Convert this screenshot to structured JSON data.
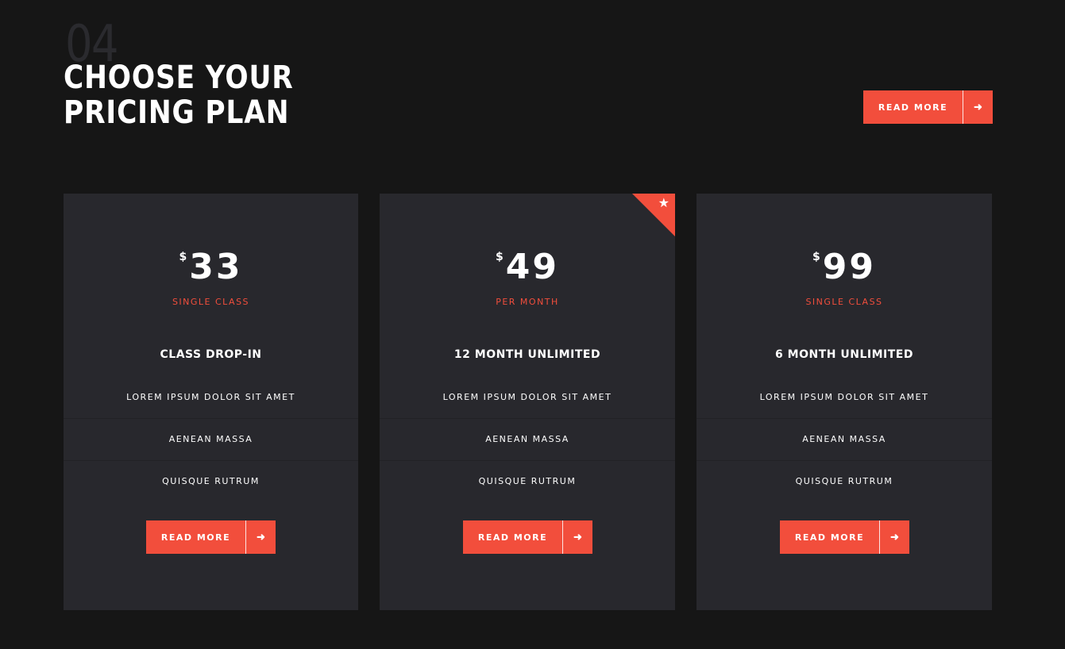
{
  "header": {
    "section_number": "04",
    "title_line1": "CHOOSE YOUR",
    "title_line2": "PRICING PLAN",
    "button_label": "READ MORE",
    "button_icon": "arrow-right-icon"
  },
  "colors": {
    "background": "#161616",
    "card": "#28282d",
    "accent": "#f24e3c",
    "text": "#ffffff"
  },
  "plans": [
    {
      "currency": "$",
      "amount": "33",
      "period": "SINGLE CLASS",
      "name": "CLASS DROP-IN",
      "featured": false,
      "features": [
        "LOREM IPSUM DOLOR SIT AMET",
        "AENEAN MASSA",
        "QUISQUE RUTRUM"
      ],
      "button_label": "READ MORE"
    },
    {
      "currency": "$",
      "amount": "49",
      "period": "PER MONTH",
      "name": "12 MONTH UNLIMITED",
      "featured": true,
      "featured_icon": "star-icon",
      "features": [
        "LOREM IPSUM DOLOR SIT AMET",
        "AENEAN MASSA",
        "QUISQUE RUTRUM"
      ],
      "button_label": "READ MORE"
    },
    {
      "currency": "$",
      "amount": "99",
      "period": "SINGLE CLASS",
      "name": "6 MONTH UNLIMITED",
      "featured": false,
      "features": [
        "LOREM IPSUM DOLOR SIT AMET",
        "AENEAN MASSA",
        "QUISQUE RUTRUM"
      ],
      "button_label": "READ MORE"
    }
  ]
}
